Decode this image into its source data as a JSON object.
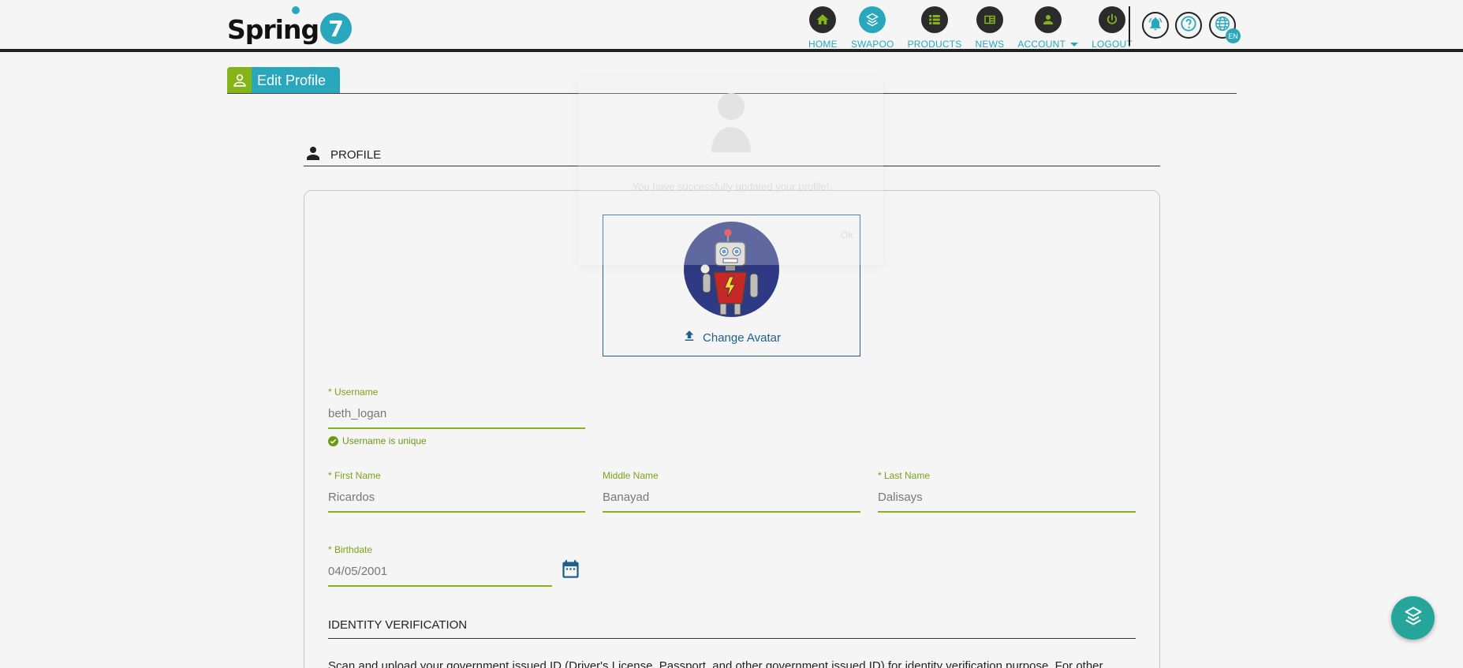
{
  "header": {
    "logo": {
      "text": "Spring",
      "badge": "7"
    },
    "nav": [
      {
        "key": "home",
        "label": "HOME",
        "icon": "home-icon",
        "active": false
      },
      {
        "key": "swapoo",
        "label": "SWAPOO",
        "icon": "swapoo-icon",
        "active": true
      },
      {
        "key": "products",
        "label": "PRODUCTS",
        "icon": "list-icon",
        "active": false
      },
      {
        "key": "news",
        "label": "NEWS",
        "icon": "newspaper-icon",
        "active": false
      },
      {
        "key": "account",
        "label": "ACCOUNT",
        "icon": "person-icon",
        "active": false,
        "has_caret": true
      },
      {
        "key": "logout",
        "label": "LOGOUT",
        "icon": "power-icon",
        "active": false
      }
    ],
    "utilities": {
      "notifications_icon": "bell-icon",
      "help_icon": "help-icon",
      "language_icon": "globe-icon",
      "language_code": "EN"
    }
  },
  "page": {
    "title": "Edit Profile",
    "title_icon": "person-outline-icon",
    "section_label": "PROFILE",
    "section_icon": "person-icon"
  },
  "popup": {
    "message": "You have successfully updated your profile!",
    "ok_label": "Ok"
  },
  "avatar": {
    "change_label": "Change Avatar",
    "upload_icon": "upload-icon"
  },
  "form": {
    "username": {
      "label": "* Username",
      "value": "beth_logan",
      "hint": "Username is unique"
    },
    "first_name": {
      "label": "* First Name",
      "value": "Ricardos"
    },
    "middle_name": {
      "label": "Middle Name",
      "value": "Banayad"
    },
    "last_name": {
      "label": "* Last Name",
      "value": "Dalisays"
    },
    "birthdate": {
      "label": "* Birthdate",
      "value": "04/05/2001"
    }
  },
  "identity": {
    "heading": "IDENTITY VERIFICATION",
    "text": "Scan and upload your government issued ID (Driver's License, Passport, and other government issued ID) for identity verification purpose. For other"
  },
  "colors": {
    "accent": "#28a7bd",
    "green": "#84b418",
    "dark": "#2b2b2b",
    "fab": "#26a69a"
  }
}
